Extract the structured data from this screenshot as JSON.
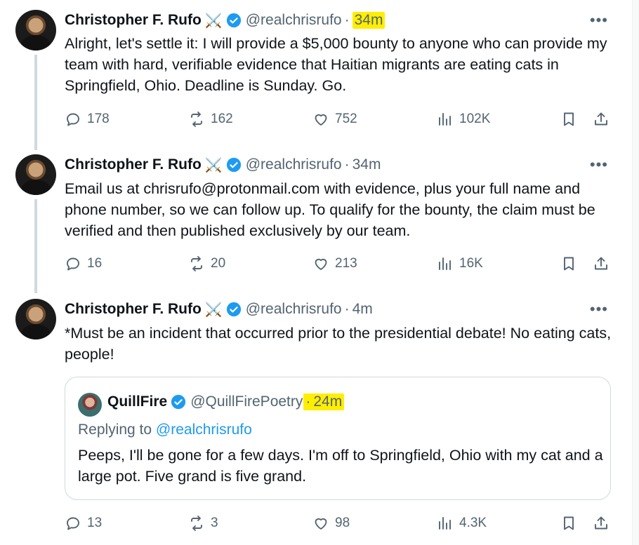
{
  "tweets": [
    {
      "name": "Christopher F. Rufo",
      "emoji": "⚔️",
      "handle": "@realchrisrufo",
      "time": "34m",
      "text": "Alright, let's settle it: I will provide a $5,000 bounty to anyone who can provide my team with hard, verifiable evidence that Haitian migrants are eating cats in Springfield, Ohio. Deadline is Sunday. Go.",
      "replies": "178",
      "reposts": "162",
      "likes": "752",
      "views": "102K"
    },
    {
      "name": "Christopher F. Rufo",
      "emoji": "⚔️",
      "handle": "@realchrisrufo",
      "time": "34m",
      "text": "Email us at chrisrufo@protonmail.com with evidence, plus your full name and phone number, so we can follow up. To qualify for the bounty, the claim must be verified and then published exclusively by our team.",
      "replies": "16",
      "reposts": "20",
      "likes": "213",
      "views": "16K"
    },
    {
      "name": "Christopher F. Rufo",
      "emoji": "⚔️",
      "handle": "@realchrisrufo",
      "time": "4m",
      "text": "*Must be an incident that occurred prior to the presidential debate! No eating cats, people!",
      "replies": "13",
      "reposts": "3",
      "likes": "98",
      "views": "4.3K"
    }
  ],
  "quote": {
    "name": "QuillFire",
    "handle": "@QuillFirePoetry",
    "time": "24m",
    "replying_prefix": "Replying to ",
    "replying_to": "@realchrisrufo",
    "text": "Peeps, I'll be gone for a few days. I'm off to Springfield, Ohio with my cat and a large pot. Five grand is five grand."
  },
  "separator": "·",
  "more_label": "•••",
  "colors": {
    "accent": "#1d9bf0",
    "highlight": "#ffee00",
    "muted": "#536471"
  }
}
